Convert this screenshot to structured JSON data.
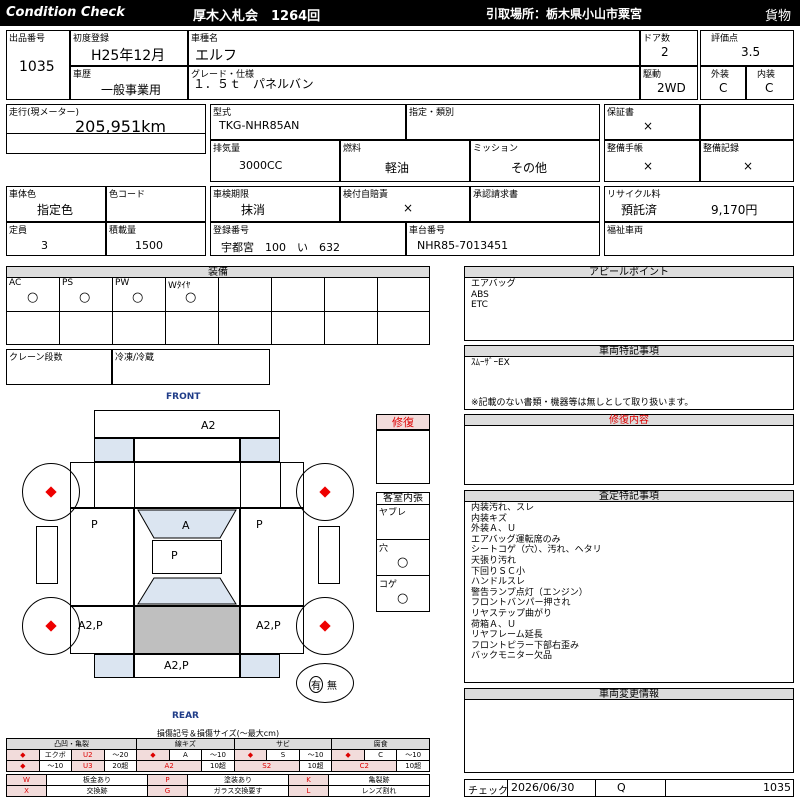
{
  "header": {
    "condition_check": "Condition Check",
    "auction": "厚木入札会　1264回",
    "pickup": "引取場所：栃木県小山市粟宮",
    "category": "貨物"
  },
  "top": {
    "lot_label": "出品番号",
    "lot": "1035",
    "reg_label": "初度登録",
    "reg": "H25年12月",
    "name_label": "車種名",
    "name": "エルフ",
    "doors_label": "ドア数",
    "doors": "2",
    "score_label": "評価点",
    "score": "3.5",
    "history_label": "車歴",
    "history": "一般事業用",
    "grade_label": "グレード・仕様",
    "grade": "１．５ｔ　パネルバン",
    "drive_label": "駆動",
    "drive": "2WD",
    "exterior_label": "外装",
    "exterior": "C",
    "interior_label": "内装",
    "interior": "C"
  },
  "mid": {
    "mileage_label": "走行(現メーター)",
    "mileage": "205,951km",
    "model_label": "型式",
    "model": "TKG-NHR85AN",
    "design_label": "指定・類別",
    "warranty_label": "保証書",
    "warranty": "×",
    "displacement_label": "排気量",
    "displacement": "3000CC",
    "fuel_label": "燃料",
    "fuel": "軽油",
    "mission_label": "ミッション",
    "mission": "その他",
    "manual_label": "整備手帳",
    "manual": "×",
    "record_label": "整備記録",
    "record": "×",
    "color_label": "車体色",
    "color": "指定色",
    "colorcode_label": "色コード",
    "inspection_label": "車検期限",
    "inspection": "抹消",
    "liability_label": "検付自賠責",
    "liability": "×",
    "approval_label": "承認請求書",
    "recycle_label": "リサイクル料",
    "recycle_status": "預託済",
    "recycle_amount": "9,170円",
    "capacity_label": "定員",
    "capacity": "3",
    "load_label": "積載量",
    "load": "1500",
    "plate_label": "登録番号",
    "plate": "宇都宮　100　い　632",
    "chassis_label": "車台番号",
    "chassis": "NHR85-7013451",
    "welfare_label": "福祉車両"
  },
  "equipment": {
    "title": "装備",
    "items": [
      {
        "label": "AC",
        "mark": "○"
      },
      {
        "label": "PS",
        "mark": "○"
      },
      {
        "label": "PW",
        "mark": "○"
      },
      {
        "label": "Wﾀｲﾔ",
        "mark": "○"
      }
    ],
    "crane_label": "クレーン段数",
    "freezer_label": "冷凍/冷蔵"
  },
  "diagram": {
    "front": "FRONT",
    "rear": "REAR",
    "front_mark": "A2",
    "left_mid": "P",
    "center": "A",
    "right_mid": "P",
    "inner": "P",
    "left_rear": "A2,P",
    "right_rear": "A2,P",
    "rear_mark": "A2,P",
    "flag_yes": "有",
    "flag_no": "無"
  },
  "repair": {
    "title": "修復"
  },
  "cabin": {
    "title": "客室内張",
    "items": [
      {
        "label": "ヤブレ",
        "mark": ""
      },
      {
        "label": "穴",
        "mark": "○"
      },
      {
        "label": "コゲ",
        "mark": "○"
      }
    ]
  },
  "appeal": {
    "title": "アピールポイント",
    "lines": [
      "エアバッグ",
      "ABS",
      "ETC"
    ]
  },
  "special": {
    "title": "車両特記事項",
    "lines": [
      "ｽﾑｰｻﾞｰEX"
    ],
    "note": "※記載のない書類・機器等は無しとして取り扱います。"
  },
  "repair_content": {
    "title": "修復内容"
  },
  "assessment": {
    "title": "査定特記事項",
    "lines": [
      "内装汚れ、スレ",
      "内装キズ",
      "外装Ａ、Ｕ",
      "エアバッグ運転席のみ",
      "シートコゲ（穴）、汚れ、ヘタリ",
      "天張り汚れ",
      "下回りＳＣ小",
      "ハンドルスレ",
      "警告ランプ点灯（エンジン）",
      "フロントバンパー押され",
      "リヤステップ曲がり",
      "荷箱Ａ、Ｕ",
      "リヤフレーム延長",
      "フロントピラー下部右歪み",
      "バックモニター欠品"
    ]
  },
  "change": {
    "title": "車両変更情報"
  },
  "check": {
    "label": "チェック",
    "date": "2026/06/30",
    "checker": "Q",
    "lot": "1035"
  },
  "legend": {
    "title": "損傷記号＆損傷サイズ(〜最大cm)",
    "groups": [
      "凸凹・亀裂",
      "線キズ",
      "サビ",
      "腐食"
    ],
    "row1": [
      "◆",
      "エクボ",
      "U2",
      "〜20",
      "◆",
      "A",
      "〜10",
      "◆",
      "S",
      "〜10",
      "◆",
      "C",
      "〜10"
    ],
    "row2": [
      "◆",
      "〜10",
      "U3",
      "20超",
      "A2",
      "10超",
      "S2",
      "10超",
      "C2",
      "10超"
    ],
    "row3": [
      "W",
      "板金あり",
      "P",
      "塗装あり",
      "K",
      "亀裂跡"
    ],
    "row4": [
      "X",
      "交換跡",
      "G",
      "ガラス交換要す",
      "L",
      "レンズ割れ"
    ]
  }
}
